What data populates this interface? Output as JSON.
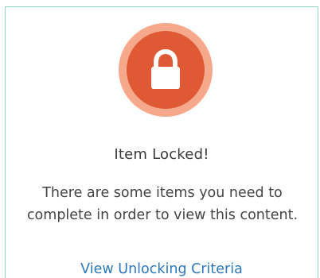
{
  "lock_panel": {
    "icon": "lock-icon",
    "title": "Item Locked!",
    "message": "There are some items you need to complete in order to view this content.",
    "link_label": "View Unlocking Criteria"
  },
  "colors": {
    "badge_outer": "#f6a88b",
    "badge_inner": "#df5a34",
    "link": "#2f77b8",
    "border": "#8fd8c6"
  }
}
